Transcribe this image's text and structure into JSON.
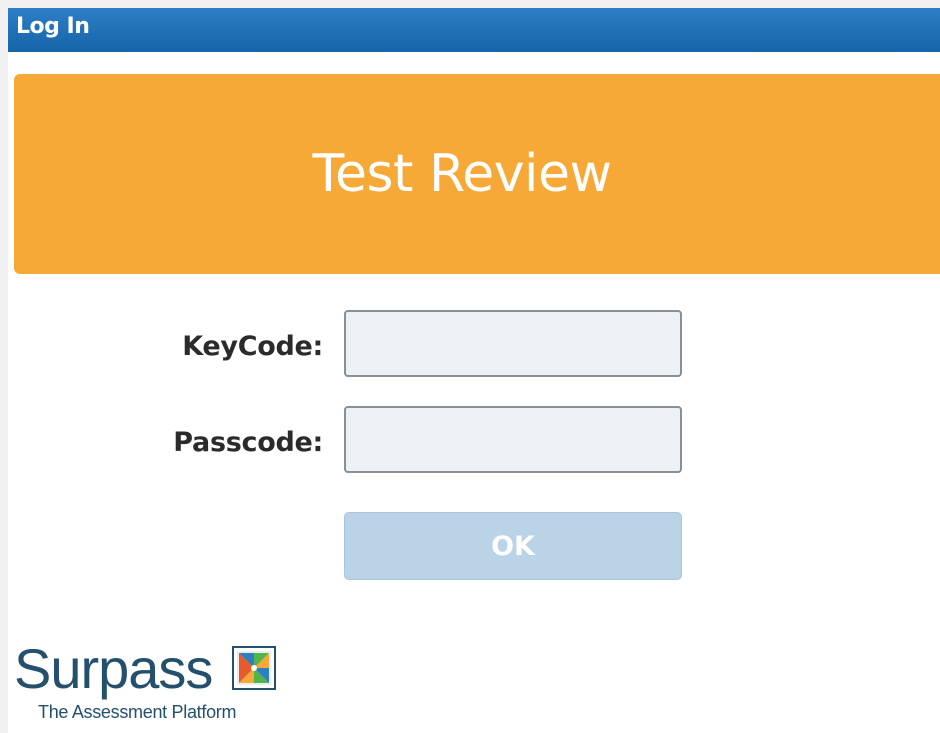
{
  "window": {
    "title": "Log In"
  },
  "banner": {
    "title": "Test Review",
    "color": "#f7a937"
  },
  "form": {
    "keycode": {
      "label": "KeyCode:",
      "value": "",
      "placeholder": ""
    },
    "passcode": {
      "label": "Passcode:",
      "value": "",
      "placeholder": ""
    },
    "ok_label": "OK"
  },
  "branding": {
    "name": "Surpass",
    "tagline": "The Assessment Platform",
    "logo_icon": "surpass-logo-icon",
    "color": "#244f6d"
  },
  "colors": {
    "titlebar": "#1664a8",
    "button_disabled": "#bad3e7"
  }
}
